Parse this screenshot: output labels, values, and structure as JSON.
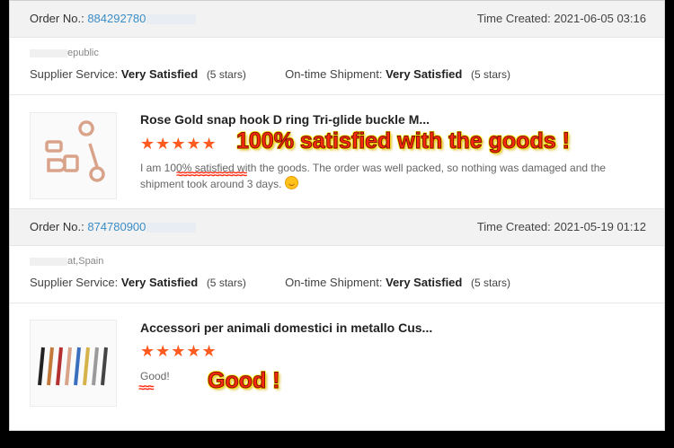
{
  "orders": [
    {
      "order_label": "Order No.:",
      "order_number": "884292780",
      "time_label": "Time Created:",
      "time_value": "2021-06-05 03:16",
      "location": "epublic",
      "supplier_label": "Supplier Service:",
      "supplier_value": "Very Satisfied",
      "supplier_stars": "(5 stars)",
      "shipment_label": "On-time Shipment:",
      "shipment_value": "Very Satisfied",
      "shipment_stars": "(5 stars)",
      "product_title": "Rose Gold snap hook D ring Tri-glide buckle M...",
      "rating_stars": "★★★★★",
      "review_text": "I am 100% satisfied with the goods. The order was well packed, so nothing was damaged and the shipment took around 3 days.",
      "highlight": "100% satisfied with the goods !"
    },
    {
      "order_label": "Order No.:",
      "order_number": "874780900",
      "time_label": "Time Created:",
      "time_value": "2021-05-19 01:12",
      "location": "at,Spain",
      "supplier_label": "Supplier Service:",
      "supplier_value": "Very Satisfied",
      "supplier_stars": "(5 stars)",
      "shipment_label": "On-time Shipment:",
      "shipment_value": "Very Satisfied",
      "shipment_stars": "(5 stars)",
      "product_title": "Accessori per animali domestici in metallo Cus...",
      "rating_stars": "★★★★★",
      "review_text": "Good!",
      "highlight": "Good !"
    }
  ],
  "colors": {
    "accent_orange": "#ff5a1f",
    "link_blue": "#3a8cc7",
    "highlight_red": "#ff2a0e"
  }
}
